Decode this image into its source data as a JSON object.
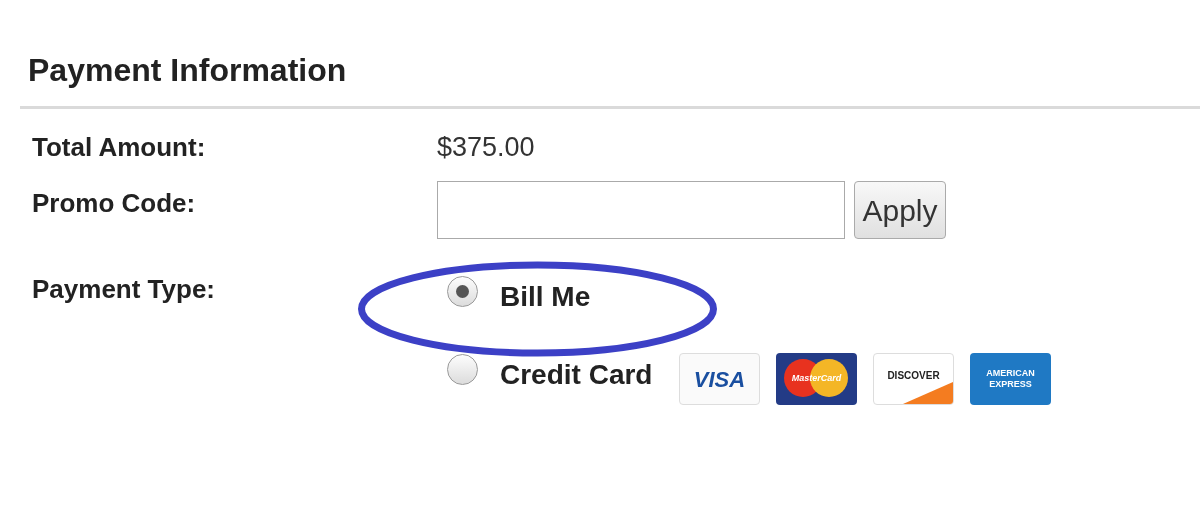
{
  "section": {
    "title": "Payment Information"
  },
  "total": {
    "label": "Total Amount:",
    "value": "$375.00"
  },
  "promo": {
    "label": "Promo Code:",
    "button": "Apply"
  },
  "payment_type": {
    "label": "Payment Type:",
    "options": [
      {
        "label": "Bill Me",
        "selected": true
      },
      {
        "label": "Credit Card",
        "selected": false,
        "cards": [
          {
            "kind": "visa",
            "label": "VISA"
          },
          {
            "kind": "mastercard",
            "label": "MasterCard"
          },
          {
            "kind": "discover",
            "label": "DISCOVER"
          },
          {
            "kind": "amex",
            "label": "AMERICAN EXPRESS"
          }
        ]
      }
    ]
  }
}
